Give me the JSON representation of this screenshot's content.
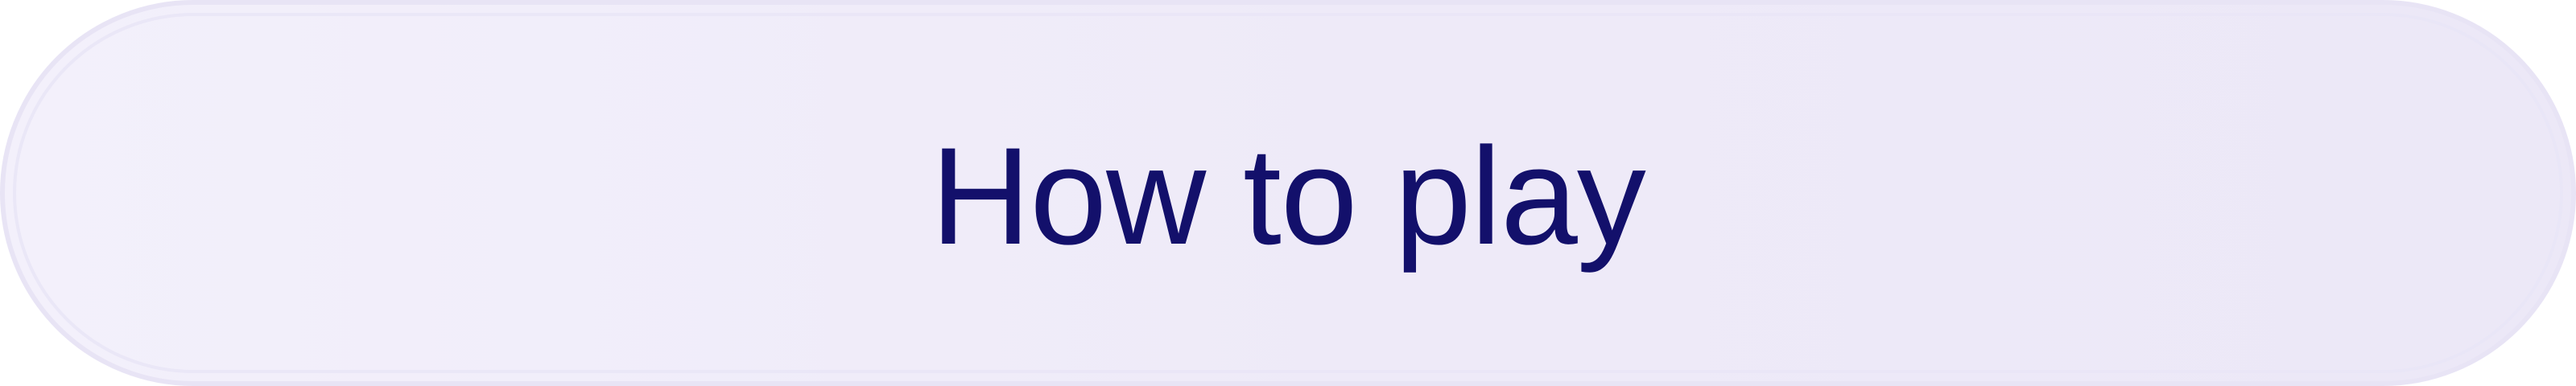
{
  "button": {
    "label": "How to play"
  },
  "colors": {
    "text": "#13106b",
    "background_start": "#f3f0fb",
    "background_end": "#ece8f7",
    "border": "#e8e4f5"
  }
}
